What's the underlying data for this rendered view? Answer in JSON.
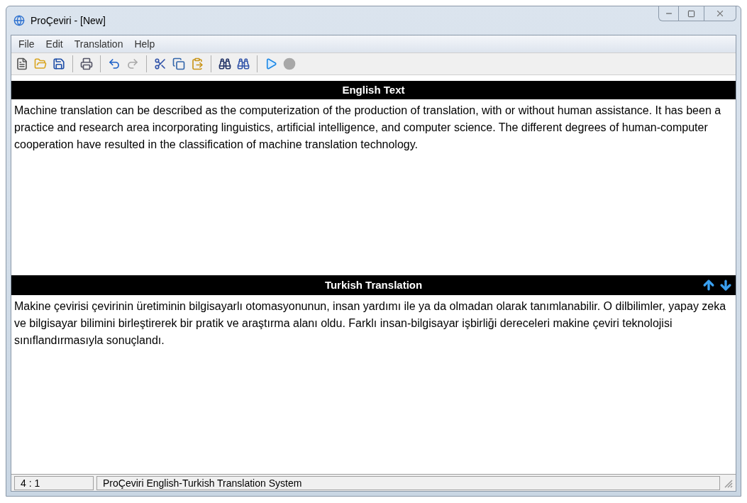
{
  "window": {
    "title": "ProÇeviri - [New]"
  },
  "menu": [
    "File",
    "Edit",
    "Translation",
    "Help"
  ],
  "toolbar": [
    {
      "kind": "new",
      "disabled": false
    },
    {
      "kind": "open",
      "disabled": false
    },
    {
      "kind": "save",
      "disabled": false
    },
    {
      "kind": "sep"
    },
    {
      "kind": "print",
      "disabled": false
    },
    {
      "kind": "sep"
    },
    {
      "kind": "undo",
      "disabled": false
    },
    {
      "kind": "redo",
      "disabled": true
    },
    {
      "kind": "sep"
    },
    {
      "kind": "cut",
      "disabled": false
    },
    {
      "kind": "copy",
      "disabled": false
    },
    {
      "kind": "paste",
      "disabled": false
    },
    {
      "kind": "sep"
    },
    {
      "kind": "find",
      "disabled": false
    },
    {
      "kind": "findnext",
      "disabled": false
    },
    {
      "kind": "sep"
    },
    {
      "kind": "play",
      "disabled": false
    },
    {
      "kind": "stop",
      "disabled": true
    }
  ],
  "source": {
    "header": "English Text",
    "text": "Machine translation can be described as the computerization of the production of translation, with or without human assistance. It has been a practice and research area incorporating linguistics, artificial intelligence, and computer science. The different degrees of human-computer cooperation have resulted in the classification of machine translation technology."
  },
  "target": {
    "header": "Turkish Translation",
    "text": "Makine çevirisi çevirinin üretiminin bilgisayarlı otomasyonunun, insan yardımı ile ya da olmadan olarak tanımlanabilir. O dilbilimler, yapay zeka ve bilgisayar bilimini birleştirerek bir pratik ve araştırma alanı oldu. Farklı insan-bilgisayar işbirliği dereceleri makine çeviri teknolojisi sınıflandırmasıyla sonuçlandı."
  },
  "status_bar": {
    "position": "4 : 1",
    "message": "ProÇeviri English-Turkish Translation System"
  }
}
